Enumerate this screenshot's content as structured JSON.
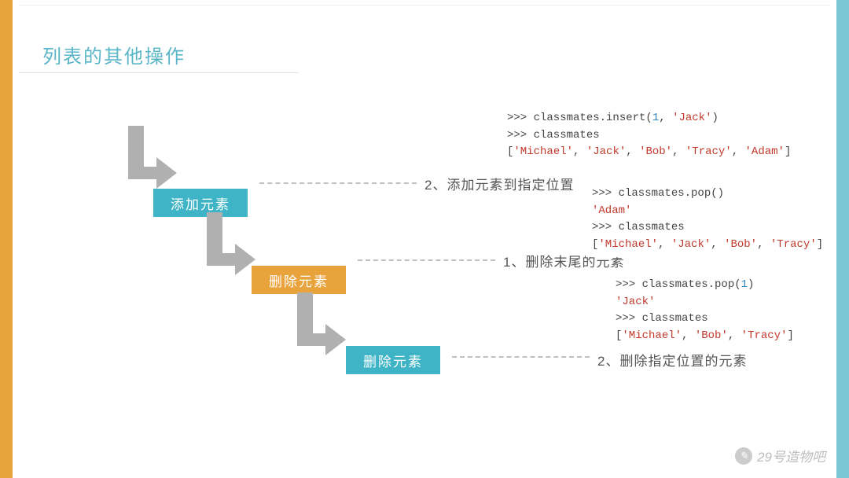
{
  "title": "列表的其他操作",
  "flow": {
    "step1": {
      "label": "添加元素",
      "caption": "2、添加元素到指定位置"
    },
    "step2": {
      "label": "删除元素",
      "caption": "1、删除末尾的元素"
    },
    "step3": {
      "label": "删除元素",
      "caption": "2、删除指定位置的元素"
    }
  },
  "code": {
    "insert": {
      "l1a": ">>> classmates.insert(",
      "l1n": "1",
      "l1m": ", ",
      "l1s": "'Jack'",
      "l1b": ")",
      "l2": ">>> classmates",
      "l3a": "[",
      "l3s1": "'Michael'",
      "l3c": ", ",
      "l3s2": "'Jack'",
      "l3s3": "'Bob'",
      "l3s4": "'Tracy'",
      "l3s5": "'Adam'",
      "l3b": "]"
    },
    "pop": {
      "l1": ">>> classmates.pop()",
      "l2": "'Adam'",
      "l3": ">>> classmates",
      "l4a": "[",
      "l4s1": "'Michael'",
      "l4c": ", ",
      "l4s2": "'Jack'",
      "l4s3": "'Bob'",
      "l4s4": "'Tracy'",
      "l4b": "]"
    },
    "popi": {
      "l1a": ">>> classmates.pop(",
      "l1n": "1",
      "l1b": ")",
      "l2": "'Jack'",
      "l3": ">>> classmates",
      "l4a": "[",
      "l4s1": "'Michael'",
      "l4c": ", ",
      "l4s2": "'Bob'",
      "l4s3": "'Tracy'",
      "l4b": "]"
    }
  },
  "watermark": "29号造物吧"
}
